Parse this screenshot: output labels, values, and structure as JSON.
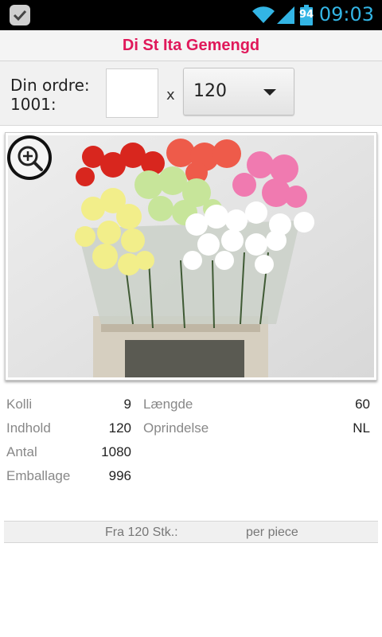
{
  "status_bar": {
    "battery_level": "94",
    "time": "09:03",
    "accent_color": "#33b5e5",
    "icons": [
      "app-check-icon",
      "wifi-icon",
      "signal-icon",
      "battery-icon"
    ]
  },
  "header": {
    "title": "Di St Ita Gemengd",
    "title_color": "#e0185a"
  },
  "order": {
    "label_line1": "Din ordre:",
    "label_line2": "1001:",
    "quantity_value": "",
    "multiply_sign": "x",
    "selected_pack": "120"
  },
  "product_image": {
    "zoom_icon": "zoom-in-icon"
  },
  "specs": {
    "left": [
      {
        "label": "Kolli",
        "value": "9"
      },
      {
        "label": "Indhold",
        "value": "120"
      },
      {
        "label": "Antal",
        "value": "1080"
      },
      {
        "label": "Emballage",
        "value": "996"
      }
    ],
    "right": [
      {
        "label": "Længde",
        "value": "60"
      },
      {
        "label": "Oprindelse",
        "value": "NL"
      }
    ]
  },
  "price": {
    "from_label": "Fra 120 Stk.:",
    "unit_label": "per piece"
  }
}
